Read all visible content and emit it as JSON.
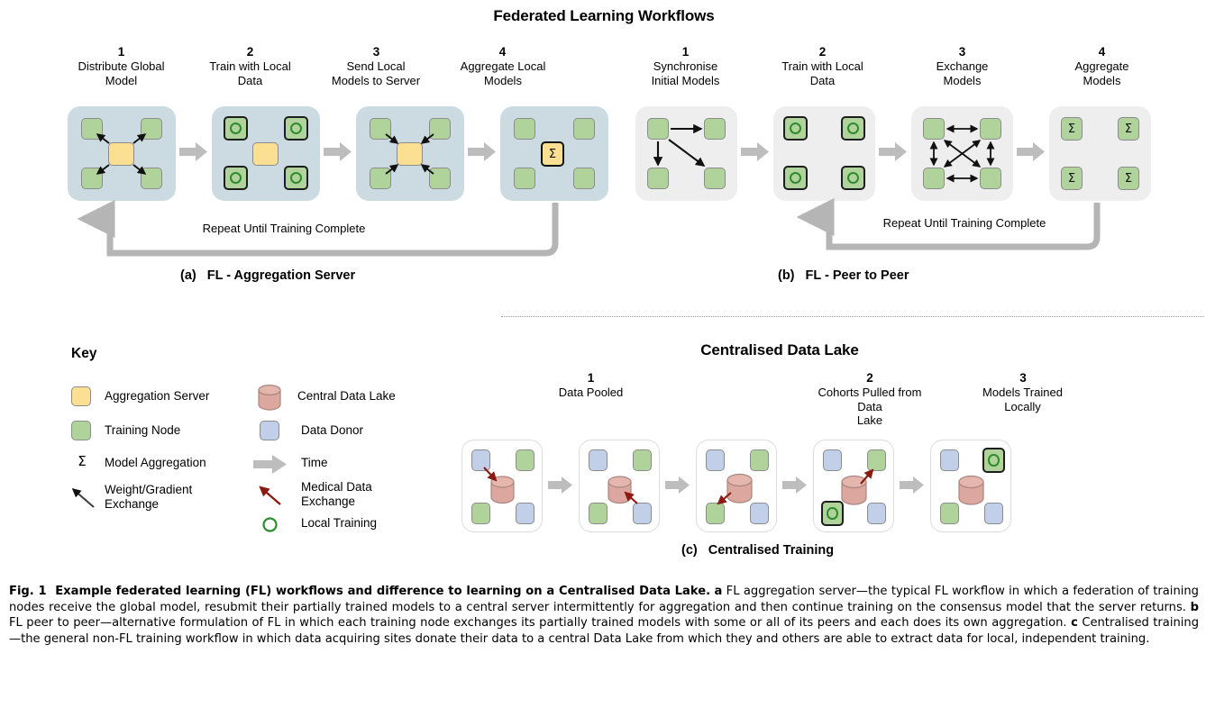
{
  "figure": {
    "title": "Federated Learning Workflows",
    "section2_title": "Centralised Data Lake",
    "fig_label": "Fig. 1",
    "caption_bold": "Example federated learning (FL) workflows and difference to learning on a Centralised Data Lake.",
    "caption_a_tag": "a",
    "caption_a_text": "FL aggregation server—the typical FL workflow in which a federation of training nodes receive the global model, resubmit their partially trained models to a central server intermittently for aggregation and then continue training on the consensus model that the server returns.",
    "caption_b_tag": "b",
    "caption_b_text": "FL peer to peer—alternative formulation of FL in which each training node exchanges its partially trained models with some or all of its peers and each does its own aggregation.",
    "caption_c_tag": "c",
    "caption_c_text": "Centralised training—the general non-FL training workflow in which data acquiring sites donate their data to a central Data Lake from which they and others are able to extract data for local, independent training."
  },
  "panel_a": {
    "tag": "(a)",
    "caption": "FL - Aggregation Server",
    "loop_label": "Repeat Until Training Complete",
    "steps": [
      {
        "num": "1",
        "label": "Distribute Global\nModel"
      },
      {
        "num": "2",
        "label": "Train with Local\nData"
      },
      {
        "num": "3",
        "label": "Send Local\nModels to Server"
      },
      {
        "num": "4",
        "label": "Aggregate Local\nModels"
      }
    ]
  },
  "panel_b": {
    "tag": "(b)",
    "caption": "FL - Peer to Peer",
    "loop_label": "Repeat Until Training Complete",
    "steps": [
      {
        "num": "1",
        "label": "Synchronise\nInitial Models"
      },
      {
        "num": "2",
        "label": "Train with Local\nData"
      },
      {
        "num": "3",
        "label": "Exchange\nModels"
      },
      {
        "num": "4",
        "label": "Aggregate\nModels"
      }
    ]
  },
  "panel_c": {
    "tag": "(c)",
    "caption": "Centralised Training",
    "steps": [
      {
        "num": "1",
        "label": "Data Pooled"
      },
      {
        "num": "2",
        "label": "Cohorts Pulled from Data\nLake"
      },
      {
        "num": "3",
        "label": "Models Trained\nLocally"
      }
    ]
  },
  "key": {
    "title": "Key",
    "left_items": [
      {
        "icon": "yellow-square-icon",
        "label": "Aggregation Server"
      },
      {
        "icon": "green-square-icon",
        "label": "Training Node"
      },
      {
        "icon": "sigma-icon",
        "label": "Model Aggregation"
      },
      {
        "icon": "black-arrow-icon",
        "label": "Weight/Gradient\nExchange"
      }
    ],
    "right_items": [
      {
        "icon": "cylinder-icon",
        "label": "Central Data Lake"
      },
      {
        "icon": "blue-square-icon",
        "label": "Data Donor"
      },
      {
        "icon": "gray-block-arrow-icon",
        "label": "Time"
      },
      {
        "icon": "red-arrow-icon",
        "label": "Medical Data\nExchange"
      },
      {
        "icon": "green-ring-icon",
        "label": "Local Training"
      }
    ]
  },
  "symbols": {
    "sigma": "Σ"
  },
  "colors": {
    "aggregation_server": "#fbdf93",
    "training_node": "#b0d39b",
    "data_donor": "#c2cfe9",
    "data_lake": "#dca79f",
    "panel_a_bg": "#ccdbe1",
    "panel_b_bg": "#eeeeee",
    "time_arrow": "#bdbdbd",
    "medical_exchange_arrow": "#8b1a10",
    "local_training_ring": "#2e8b2e"
  }
}
